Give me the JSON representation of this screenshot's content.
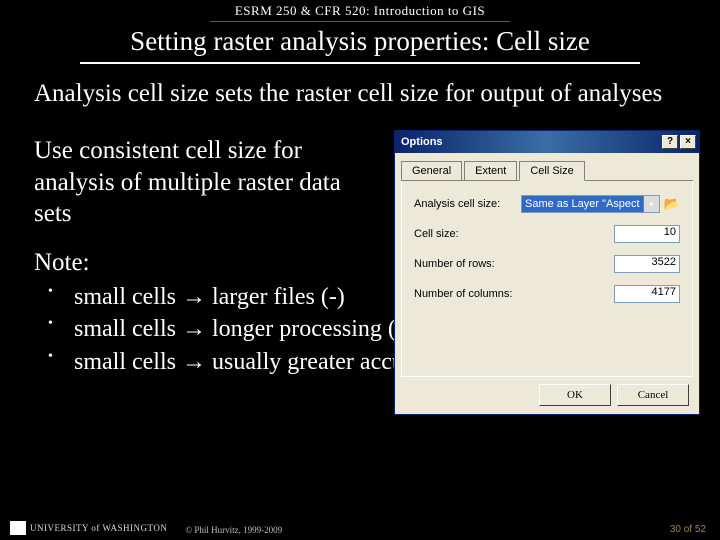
{
  "course": "ESRM 250 & CFR 520: Introduction to GIS",
  "title": "Setting raster analysis properties: Cell size",
  "para1": "Analysis cell size sets the raster cell size for output of analyses",
  "para2": "Use consistent cell size for analysis of multiple raster data sets",
  "note_head": "Note:",
  "notes": [
    "small cells → larger files (-)",
    "small cells → longer processing (-), but …",
    "small cells → usually greater accuracy (+)"
  ],
  "dialog": {
    "title": "Options",
    "help_btn": "?",
    "close_btn": "×",
    "tabs": [
      "General",
      "Extent",
      "Cell Size"
    ],
    "active_tab": 2,
    "fields": {
      "analysis_label": "Analysis cell size:",
      "analysis_value": "Same as Layer \"Aspect of",
      "cellsize_label": "Cell size:",
      "cellsize_value": "10",
      "rows_label": "Number of rows:",
      "rows_value": "3522",
      "cols_label": "Number of columns:",
      "cols_value": "4177"
    },
    "open_icon": "📂",
    "ok": "OK",
    "cancel": "Cancel"
  },
  "footer": {
    "logo_text": "UNIVERSITY of WASHINGTON",
    "copyright": "© Phil Hurvitz, 1999-2009",
    "page": "30 of 52"
  }
}
